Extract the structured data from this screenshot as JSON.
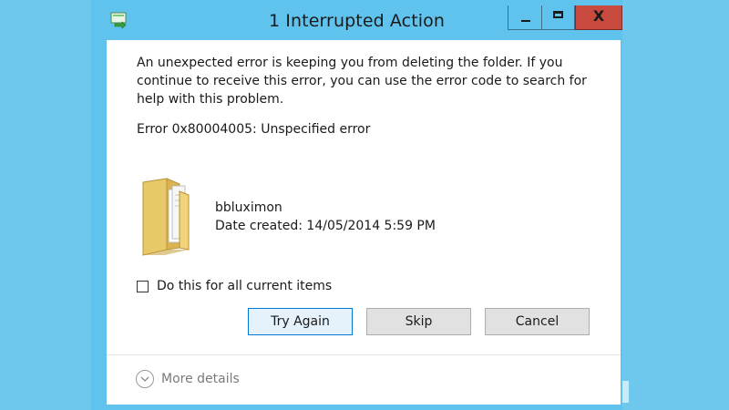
{
  "window": {
    "title": "1 Interrupted Action",
    "close_glyph": "X",
    "icons": {
      "app": "file-transfer-icon",
      "minimize": "minimize-icon",
      "maximize": "maximize-icon",
      "close": "close-icon"
    }
  },
  "dialog": {
    "message": "An unexpected error is keeping you from deleting the folder. If you continue to receive this error, you can use the error code to search for help with this problem.",
    "error_code": "Error 0x80004005: Unspecified error",
    "item": {
      "icon": "folder-icon",
      "name": "bbluximon",
      "date_created": "Date created: 14/05/2014 5:59 PM"
    },
    "checkbox_label": "Do this for all current items",
    "checkbox_checked": false,
    "buttons": {
      "try_again": "Try Again",
      "skip": "Skip",
      "cancel": "Cancel"
    },
    "more_details": "More details"
  },
  "colors": {
    "titlebar": "#60c3ee",
    "close_button": "#c84a3f",
    "background": "#6ec7ec"
  }
}
